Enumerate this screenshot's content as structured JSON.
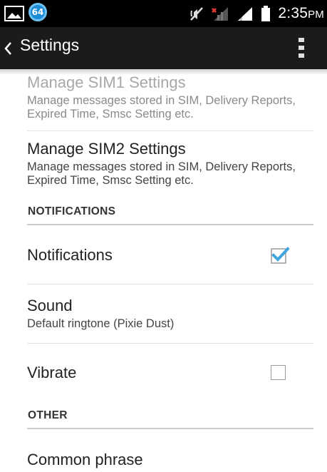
{
  "status_bar": {
    "notification_badge": "64",
    "time": "2:35",
    "time_suffix": "PM",
    "icons": [
      "gallery-icon",
      "mute-icon",
      "no-sim-signal-icon",
      "signal-icon",
      "battery-icon"
    ]
  },
  "action_bar": {
    "title": "Settings",
    "icons": [
      "chevron-left-icon",
      "overflow-menu-icon"
    ]
  },
  "settings": {
    "sim1": {
      "title": "Manage SIM1 Settings",
      "summary": "Manage messages stored in SIM, Delivery Reports, Expired Time, Smsc Setting etc."
    },
    "sim2": {
      "title": "Manage SIM2 Settings",
      "summary": "Manage messages stored in SIM, Delivery Reports, Expired Time, Smsc Setting etc."
    },
    "notifications_category": "NOTIFICATIONS",
    "notifications": {
      "title": "Notifications",
      "checked": true
    },
    "sound": {
      "title": "Sound",
      "summary": "Default ringtone (Pixie Dust)"
    },
    "vibrate": {
      "title": "Vibrate",
      "checked": false
    },
    "other_category": "OTHER",
    "common_phrase": {
      "title": "Common phrase"
    }
  },
  "colors": {
    "status_bar": "#000000",
    "action_bar": "#1b1b1b",
    "checkbox_accent": "#3ea5dd",
    "badge": "#1c8bd8"
  }
}
